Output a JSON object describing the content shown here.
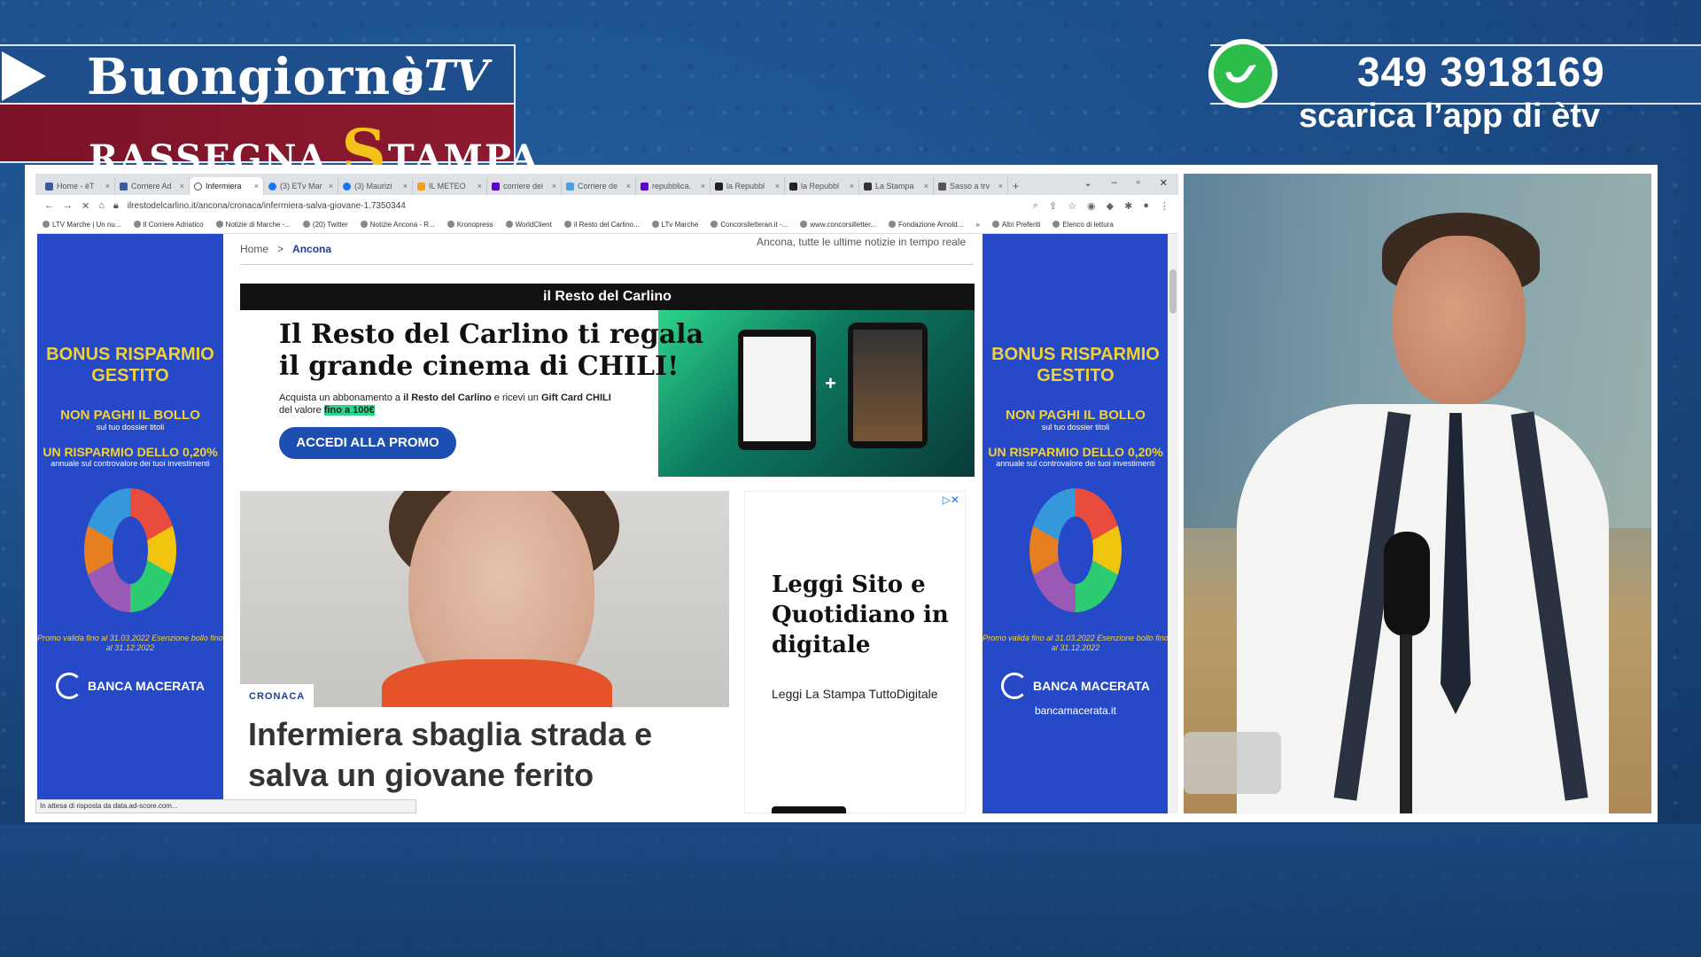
{
  "broadcast": {
    "show_title": "Buongiorno",
    "channel_logo": "èTV",
    "segment_prefix": "RASSEGNA",
    "segment_initial": "S",
    "segment_rest": "TAMPA",
    "phone": "349 3918169",
    "app_line": "scarica l’app di ètv",
    "whatsapp_color": "#2ebd4b"
  },
  "browser": {
    "tabs": [
      {
        "label": "Home - èT"
      },
      {
        "label": "Corriere Ad"
      },
      {
        "label": "Infermiera"
      },
      {
        "label": "(3) ETv Mar"
      },
      {
        "label": "(3) Maurizi"
      },
      {
        "label": "IL METEO"
      },
      {
        "label": "corriere dei"
      },
      {
        "label": "Corriere de"
      },
      {
        "label": "repubblica."
      },
      {
        "label": "la Repubbl"
      },
      {
        "label": "la Repubbl"
      },
      {
        "label": "La Stampa"
      },
      {
        "label": "Sasso a trv"
      }
    ],
    "active_tab_index": 2,
    "url": "ilrestodelcarlino.it/ancona/cronaca/infermiera-salva-giovane-1.7350344",
    "bookmarks": [
      "LTV Marche | Un nu...",
      "Il Corriere Adriatico",
      "Notizie di Marche -...",
      "(20) Twitter",
      "Notizie Ancona - R...",
      "Kronopress",
      "WorldClient",
      "il Resto del Carlino...",
      "LTv Marche",
      "Concorsiletteran.it -...",
      "www.concorsilletter...",
      "Fondazione Arnold...",
      "Altri Preferiti",
      "Elenco di lettura"
    ],
    "status_text": "In attesa di risposta da data.ad-score.com..."
  },
  "page": {
    "breadcrumb_home": "Home",
    "breadcrumb_sep": ">",
    "breadcrumb_current": "Ancona",
    "tagline": "Ancona, tutte le ultime notizie in tempo reale",
    "banner": {
      "brand": "il Resto del Carlino",
      "title_line1": "Il Resto del Carlino ti regala",
      "title_line2": "il grande cinema di CHILI!",
      "desc_part1": "Acquista un abbonamento a",
      "desc_brand": "il Resto del Carlino",
      "desc_part2": "e ricevi un",
      "desc_gift": "Gift Card CHILI",
      "desc_part3": "del valore",
      "desc_value": "fino a 100€",
      "cta": "ACCEDI ALLA PROMO"
    },
    "article": {
      "category": "CRONACA",
      "headline": "Infermiera sbaglia strada e salva un giovane ferito"
    },
    "right_ad": {
      "title": "Leggi Sito e Quotidiano in digitale",
      "subtitle": "Leggi La Stampa TuttoDigitale"
    },
    "side_ad": {
      "headline": "BONUS RISPARMIO GESTITO",
      "point1": "NON PAGHI IL BOLLO",
      "point1_small": "sul tuo dossier titoli",
      "point2": "UN RISPARMIO DELLO 0,20%",
      "point2_small": "annuale sul controvalore dei tuoi investimenti",
      "promo": "Promo valida fino al 31.03.2022 Esenzione bollo fino al 31.12.2022",
      "bank": "BANCA MACERATA",
      "bank_url": "bancamacerata.it"
    }
  }
}
